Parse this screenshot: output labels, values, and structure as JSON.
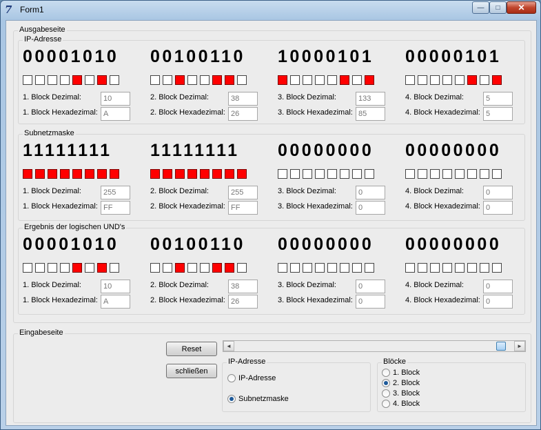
{
  "window": {
    "title": "Form1",
    "icon": "app-icon",
    "minimize": "—",
    "maximize": "□",
    "close": "✕"
  },
  "output": {
    "title": "Ausgabeseite",
    "sections": [
      {
        "title": "IP-Adresse",
        "blocks": [
          {
            "binary": "00001010",
            "bits": [
              0,
              0,
              0,
              0,
              1,
              0,
              1,
              0
            ],
            "dec_label": "1. Block Dezimal:",
            "hex_label": "1. Block Hexadezimal:",
            "dec": "10",
            "hex": "A"
          },
          {
            "binary": "00100110",
            "bits": [
              0,
              0,
              1,
              0,
              0,
              1,
              1,
              0
            ],
            "dec_label": "2. Block Dezimal:",
            "hex_label": "2. Block Hexadezimal:",
            "dec": "38",
            "hex": "26"
          },
          {
            "binary": "10000101",
            "bits": [
              1,
              0,
              0,
              0,
              0,
              1,
              0,
              1
            ],
            "dec_label": "3. Block Dezimal:",
            "hex_label": "3. Block Hexadezimal:",
            "dec": "133",
            "hex": "85"
          },
          {
            "binary": "00000101",
            "bits": [
              0,
              0,
              0,
              0,
              0,
              1,
              0,
              1
            ],
            "dec_label": "4. Block Dezimal:",
            "hex_label": "4. Block Hexadezimal:",
            "dec": "5",
            "hex": "5"
          }
        ]
      },
      {
        "title": "Subnetzmaske",
        "blocks": [
          {
            "binary": "11111111",
            "bits": [
              1,
              1,
              1,
              1,
              1,
              1,
              1,
              1
            ],
            "dec_label": "1. Block Dezimal:",
            "hex_label": "1. Block Hexadezimal:",
            "dec": "255",
            "hex": "FF"
          },
          {
            "binary": "11111111",
            "bits": [
              1,
              1,
              1,
              1,
              1,
              1,
              1,
              1
            ],
            "dec_label": "2. Block Dezimal:",
            "hex_label": "2. Block Hexadezimal:",
            "dec": "255",
            "hex": "FF"
          },
          {
            "binary": "00000000",
            "bits": [
              0,
              0,
              0,
              0,
              0,
              0,
              0,
              0
            ],
            "dec_label": "3. Block Dezimal:",
            "hex_label": "3. Block Hexadezimal:",
            "dec": "0",
            "hex": "0"
          },
          {
            "binary": "00000000",
            "bits": [
              0,
              0,
              0,
              0,
              0,
              0,
              0,
              0
            ],
            "dec_label": "4. Block Dezimal:",
            "hex_label": "4. Block Hexadezimal:",
            "dec": "0",
            "hex": "0"
          }
        ]
      },
      {
        "title": "Ergebnis der logischen UND's",
        "blocks": [
          {
            "binary": "00001010",
            "bits": [
              0,
              0,
              0,
              0,
              1,
              0,
              1,
              0
            ],
            "dec_label": "1. Block Dezimal:",
            "hex_label": "1. Block Hexadezimal:",
            "dec": "10",
            "hex": "A"
          },
          {
            "binary": "00100110",
            "bits": [
              0,
              0,
              1,
              0,
              0,
              1,
              1,
              0
            ],
            "dec_label": "2. Block Dezimal:",
            "hex_label": "2. Block Hexadezimal:",
            "dec": "38",
            "hex": "26"
          },
          {
            "binary": "00000000",
            "bits": [
              0,
              0,
              0,
              0,
              0,
              0,
              0,
              0
            ],
            "dec_label": "3. Block Dezimal:",
            "hex_label": "3. Block Hexadezimal:",
            "dec": "0",
            "hex": "0"
          },
          {
            "binary": "00000000",
            "bits": [
              0,
              0,
              0,
              0,
              0,
              0,
              0,
              0
            ],
            "dec_label": "4. Block Dezimal:",
            "hex_label": "4. Block Hexadezimal:",
            "dec": "0",
            "hex": "0"
          }
        ]
      }
    ]
  },
  "input": {
    "title": "Eingabeseite",
    "reset_label": "Reset",
    "close_label": "schließen",
    "scrollbar": {
      "left_arrow": "◄",
      "right_arrow": "►",
      "value_fraction": 0.97
    },
    "mode_group": {
      "title": "IP-Adresse",
      "options": [
        {
          "label": "IP-Adresse",
          "checked": false
        },
        {
          "label": "Subnetzmaske",
          "checked": true
        }
      ]
    },
    "block_group": {
      "title": "Blöcke",
      "options": [
        {
          "label": "1. Block",
          "checked": false
        },
        {
          "label": "2. Block",
          "checked": true
        },
        {
          "label": "3. Block",
          "checked": false
        },
        {
          "label": "4. Block",
          "checked": false
        }
      ]
    }
  },
  "colors": {
    "bit_on": "#ff0000",
    "bit_off": "#ffffff",
    "client_bg": "#ececec"
  }
}
